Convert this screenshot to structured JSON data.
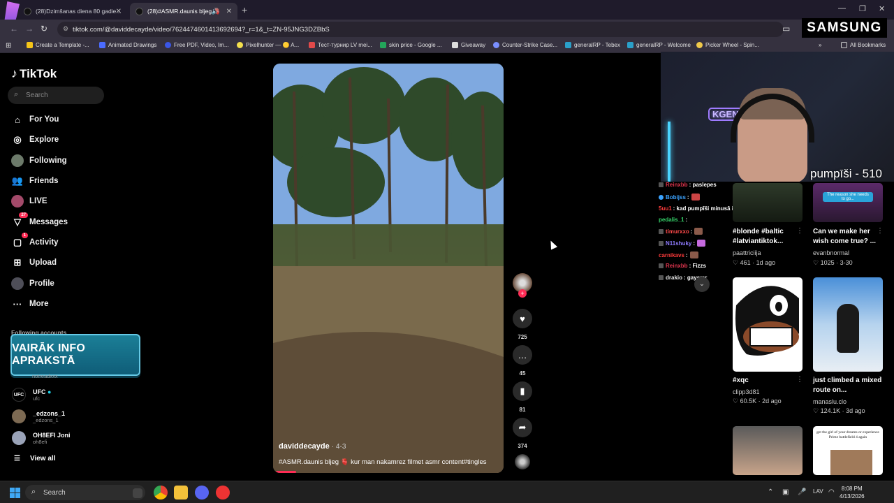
{
  "browser": {
    "tabs": [
      {
        "title": "(28)Dzimšanas diena 80 gadie..."
      },
      {
        "title": "(28)#ASMR.daunis bljeg 🫀"
      }
    ],
    "url": "tiktok.com/@daviddecayde/video/7624474601413692694?_r=1&_t=ZN-95JNG3DZBbS",
    "bookmarks": [
      "Create a Template -...",
      "Animated Drawings",
      "Free PDF, Video, Im...",
      "Pixelhunter — 🟡 A...",
      "Тест-турнир LV mei...",
      "skin price - Google ...",
      "Giveaway",
      "Counter-Strike Case...",
      "generalRP - Tebex",
      "generalRP - Welcome",
      "Picker Wheel - Spin...",
      "All Bookmarks"
    ]
  },
  "overlay": {
    "brand": "SAMSUNG",
    "webcam_neon": "KGENERAL",
    "webcam_caption": "pumpīši - 510",
    "promo_banner": "VAIRĀK INFO APRAKSTĀ"
  },
  "sidebar": {
    "logo": "TikTok",
    "search_placeholder": "Search",
    "nav": [
      {
        "label": "For You",
        "icon": "home-icon"
      },
      {
        "label": "Explore",
        "icon": "compass-icon"
      },
      {
        "label": "Following",
        "icon": "following-avatar"
      },
      {
        "label": "Friends",
        "icon": "friends-icon"
      },
      {
        "label": "LIVE",
        "icon": "live-avatar"
      },
      {
        "label": "Messages",
        "icon": "messages-icon",
        "badge": "27"
      },
      {
        "label": "Activity",
        "icon": "activity-icon",
        "badge": "1"
      },
      {
        "label": "Upload",
        "icon": "upload-icon"
      },
      {
        "label": "Profile",
        "icon": "profile-avatar"
      },
      {
        "label": "More",
        "icon": "more-icon"
      }
    ],
    "following_accounts_label": "Following accounts",
    "accounts": [
      {
        "name": "",
        "handle": "notreadxxx"
      },
      {
        "name": "UFC",
        "handle": "ufc"
      },
      {
        "name": "_edzons_1",
        "handle": "_edzons_1"
      },
      {
        "name": "OH8EFI Joni",
        "handle": "oh8efi"
      }
    ],
    "view_all": "View all"
  },
  "video": {
    "author": "daviddecayde",
    "date": "· 4-3",
    "caption": "#ASMR.daunis bljeg 🫀 kur man nakamrez filmet asmr content#tingles",
    "progress_fraction": 0.09,
    "actions": {
      "likes": "725",
      "comments": "45",
      "saves": "81",
      "shares": "374"
    }
  },
  "chat": [
    {
      "user": "Reinxbb",
      "msg": ": paslepes",
      "color": "#e0354e"
    },
    {
      "user": "Bobijss",
      "msg": ":",
      "color": "#3ba3ff"
    },
    {
      "user": "5uu1",
      "msg": ": kad pumpīši minusā ies?",
      "color": "#ff3b3b"
    },
    {
      "user": "pedalis_1",
      "msg": ":",
      "color": "#36d36a"
    },
    {
      "user": "timurxxo",
      "msg": ":",
      "color": "#ff4a4a"
    },
    {
      "user": "N11shuky",
      "msg": ":",
      "color": "#8f7bff"
    },
    {
      "user": "carnikavs",
      "msg": ":",
      "color": "#ff3b3b"
    },
    {
      "user": "Reinxbb",
      "msg": ": Fizzs",
      "color": "#e0354e"
    },
    {
      "user": "drakio",
      "msg": ": gaysmr",
      "color": "#e8e8e8"
    }
  ],
  "feed": [
    {
      "title": "#blonde #baltic #latviantiktok...",
      "author": "paattriciija",
      "likes": "461",
      "date": "1d ago"
    },
    {
      "title": "Can we make her wish come true? ...",
      "author": "evanbnormal",
      "likes": "1025",
      "date": "3-30",
      "thumb_text": "The reason she needs to go..."
    },
    {
      "title": "#xqc",
      "author": "clipp3d81",
      "likes": "60.5K",
      "date": "2d ago"
    },
    {
      "title": "just climbed a mixed route on...",
      "author": "manaslu.clo",
      "likes": "124.1K",
      "date": "3d ago"
    },
    {
      "thumb_text": "get the girl of your dreams or experience Prime battlefield 4 again"
    }
  ],
  "taskbar": {
    "search_placeholder": "Search",
    "language": "LAV",
    "time": "8:08 PM",
    "date": "4/13/2026"
  }
}
